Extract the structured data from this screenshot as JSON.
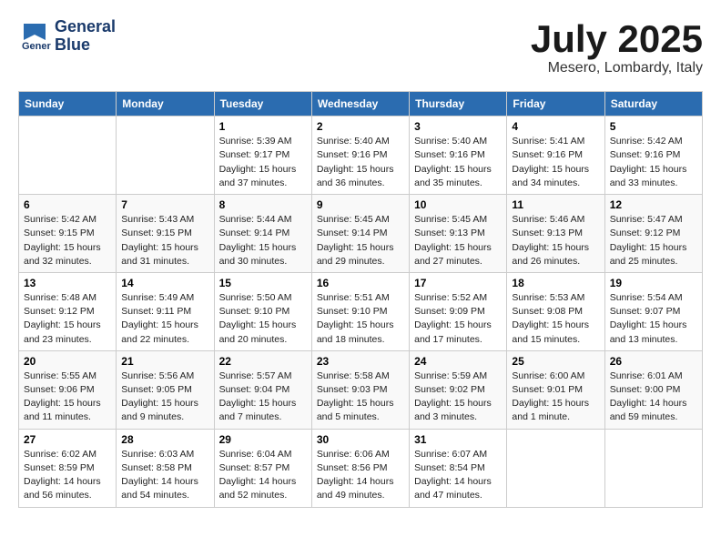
{
  "header": {
    "logo_line1": "General",
    "logo_line2": "Blue",
    "month": "July 2025",
    "location": "Mesero, Lombardy, Italy"
  },
  "days_of_week": [
    "Sunday",
    "Monday",
    "Tuesday",
    "Wednesday",
    "Thursday",
    "Friday",
    "Saturday"
  ],
  "weeks": [
    [
      {
        "day": "",
        "info": ""
      },
      {
        "day": "",
        "info": ""
      },
      {
        "day": "1",
        "info": "Sunrise: 5:39 AM\nSunset: 9:17 PM\nDaylight: 15 hours\nand 37 minutes."
      },
      {
        "day": "2",
        "info": "Sunrise: 5:40 AM\nSunset: 9:16 PM\nDaylight: 15 hours\nand 36 minutes."
      },
      {
        "day": "3",
        "info": "Sunrise: 5:40 AM\nSunset: 9:16 PM\nDaylight: 15 hours\nand 35 minutes."
      },
      {
        "day": "4",
        "info": "Sunrise: 5:41 AM\nSunset: 9:16 PM\nDaylight: 15 hours\nand 34 minutes."
      },
      {
        "day": "5",
        "info": "Sunrise: 5:42 AM\nSunset: 9:16 PM\nDaylight: 15 hours\nand 33 minutes."
      }
    ],
    [
      {
        "day": "6",
        "info": "Sunrise: 5:42 AM\nSunset: 9:15 PM\nDaylight: 15 hours\nand 32 minutes."
      },
      {
        "day": "7",
        "info": "Sunrise: 5:43 AM\nSunset: 9:15 PM\nDaylight: 15 hours\nand 31 minutes."
      },
      {
        "day": "8",
        "info": "Sunrise: 5:44 AM\nSunset: 9:14 PM\nDaylight: 15 hours\nand 30 minutes."
      },
      {
        "day": "9",
        "info": "Sunrise: 5:45 AM\nSunset: 9:14 PM\nDaylight: 15 hours\nand 29 minutes."
      },
      {
        "day": "10",
        "info": "Sunrise: 5:45 AM\nSunset: 9:13 PM\nDaylight: 15 hours\nand 27 minutes."
      },
      {
        "day": "11",
        "info": "Sunrise: 5:46 AM\nSunset: 9:13 PM\nDaylight: 15 hours\nand 26 minutes."
      },
      {
        "day": "12",
        "info": "Sunrise: 5:47 AM\nSunset: 9:12 PM\nDaylight: 15 hours\nand 25 minutes."
      }
    ],
    [
      {
        "day": "13",
        "info": "Sunrise: 5:48 AM\nSunset: 9:12 PM\nDaylight: 15 hours\nand 23 minutes."
      },
      {
        "day": "14",
        "info": "Sunrise: 5:49 AM\nSunset: 9:11 PM\nDaylight: 15 hours\nand 22 minutes."
      },
      {
        "day": "15",
        "info": "Sunrise: 5:50 AM\nSunset: 9:10 PM\nDaylight: 15 hours\nand 20 minutes."
      },
      {
        "day": "16",
        "info": "Sunrise: 5:51 AM\nSunset: 9:10 PM\nDaylight: 15 hours\nand 18 minutes."
      },
      {
        "day": "17",
        "info": "Sunrise: 5:52 AM\nSunset: 9:09 PM\nDaylight: 15 hours\nand 17 minutes."
      },
      {
        "day": "18",
        "info": "Sunrise: 5:53 AM\nSunset: 9:08 PM\nDaylight: 15 hours\nand 15 minutes."
      },
      {
        "day": "19",
        "info": "Sunrise: 5:54 AM\nSunset: 9:07 PM\nDaylight: 15 hours\nand 13 minutes."
      }
    ],
    [
      {
        "day": "20",
        "info": "Sunrise: 5:55 AM\nSunset: 9:06 PM\nDaylight: 15 hours\nand 11 minutes."
      },
      {
        "day": "21",
        "info": "Sunrise: 5:56 AM\nSunset: 9:05 PM\nDaylight: 15 hours\nand 9 minutes."
      },
      {
        "day": "22",
        "info": "Sunrise: 5:57 AM\nSunset: 9:04 PM\nDaylight: 15 hours\nand 7 minutes."
      },
      {
        "day": "23",
        "info": "Sunrise: 5:58 AM\nSunset: 9:03 PM\nDaylight: 15 hours\nand 5 minutes."
      },
      {
        "day": "24",
        "info": "Sunrise: 5:59 AM\nSunset: 9:02 PM\nDaylight: 15 hours\nand 3 minutes."
      },
      {
        "day": "25",
        "info": "Sunrise: 6:00 AM\nSunset: 9:01 PM\nDaylight: 15 hours\nand 1 minute."
      },
      {
        "day": "26",
        "info": "Sunrise: 6:01 AM\nSunset: 9:00 PM\nDaylight: 14 hours\nand 59 minutes."
      }
    ],
    [
      {
        "day": "27",
        "info": "Sunrise: 6:02 AM\nSunset: 8:59 PM\nDaylight: 14 hours\nand 56 minutes."
      },
      {
        "day": "28",
        "info": "Sunrise: 6:03 AM\nSunset: 8:58 PM\nDaylight: 14 hours\nand 54 minutes."
      },
      {
        "day": "29",
        "info": "Sunrise: 6:04 AM\nSunset: 8:57 PM\nDaylight: 14 hours\nand 52 minutes."
      },
      {
        "day": "30",
        "info": "Sunrise: 6:06 AM\nSunset: 8:56 PM\nDaylight: 14 hours\nand 49 minutes."
      },
      {
        "day": "31",
        "info": "Sunrise: 6:07 AM\nSunset: 8:54 PM\nDaylight: 14 hours\nand 47 minutes."
      },
      {
        "day": "",
        "info": ""
      },
      {
        "day": "",
        "info": ""
      }
    ]
  ]
}
